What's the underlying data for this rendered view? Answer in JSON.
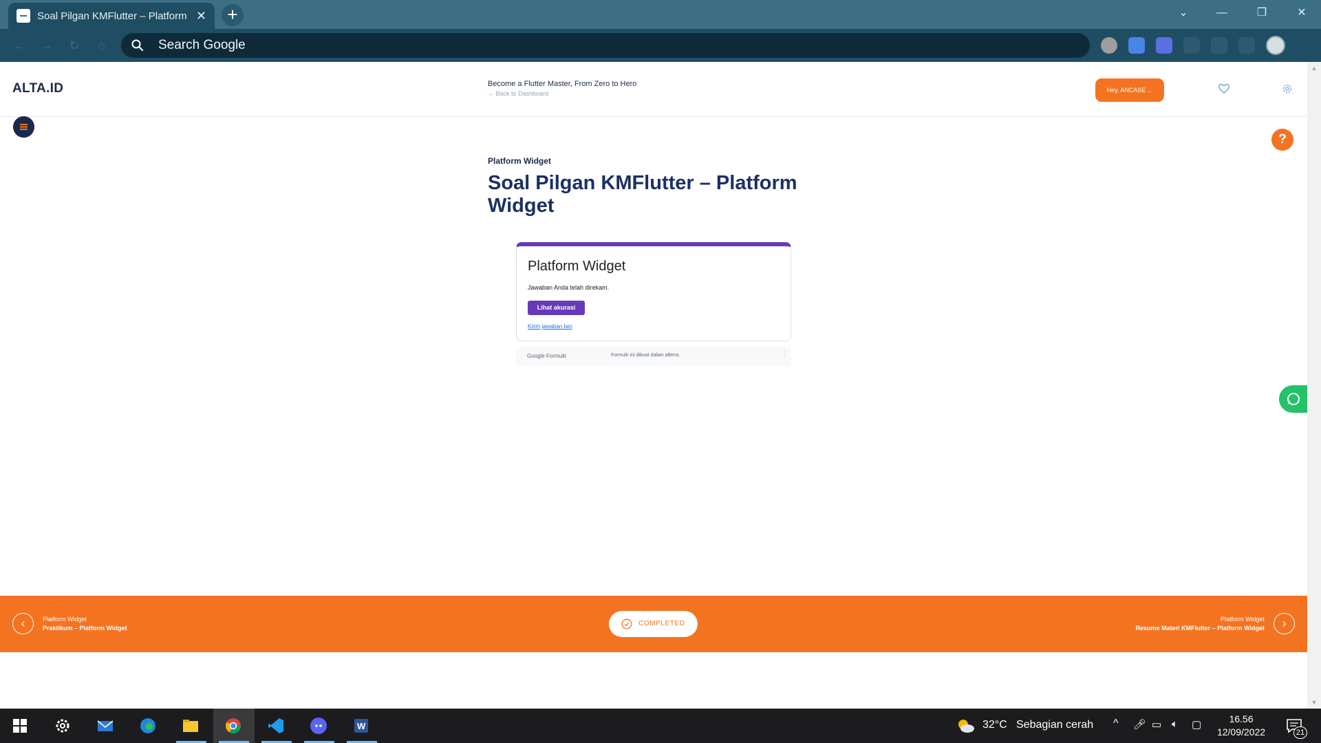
{
  "browser": {
    "tab_title": "Soal Pilgan KMFlutter – Platform",
    "omnibox_text": "Search Google"
  },
  "header": {
    "logo": "ALTA.ID",
    "course_title": "Become a Flutter Master, From Zero to Hero",
    "back_link": "←  Back to Dashboard",
    "user_button": "Hey, ANCASE ..."
  },
  "lesson": {
    "eyebrow": "Platform Widget",
    "title": "Soal Pilgan KMFlutter – Platform Widget"
  },
  "form": {
    "title": "Platform Widget",
    "message": "Jawaban Anda telah direkam.",
    "button": "Lihat akurasi",
    "link": "Kirim jawaban lain",
    "footer_brand": "Google Formulir",
    "footer_note": "Formulir ini dibuat dalam alterra.",
    "accent_color": "#673ab7"
  },
  "lesson_nav": {
    "prev_section": "Platform Widget",
    "prev_title": "Praktikum – Platform Widget",
    "status": "COMPLETED",
    "next_section": "Platform Widget",
    "next_title": "Resume Materi KMFlutter – Platform Widget",
    "accent_color": "#f47320"
  },
  "taskbar": {
    "apps": [
      "start",
      "settings",
      "mail",
      "edge",
      "file-explorer",
      "chrome",
      "vscode",
      "discord",
      "word"
    ],
    "weather_temp": "32°C",
    "weather_desc": "Sebagian cerah",
    "time": "16.56",
    "date": "12/09/2022",
    "notification_count": "21"
  }
}
